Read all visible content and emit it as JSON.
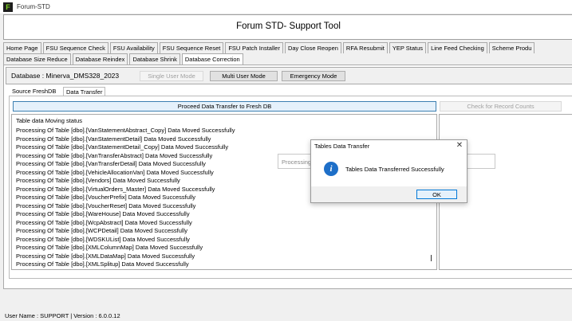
{
  "window": {
    "title": "Forum-STD",
    "icon_letter": "F"
  },
  "header": {
    "title": "Forum STD- Support Tool"
  },
  "main_tabs": [
    {
      "label": "Home Page"
    },
    {
      "label": "FSU Sequence Check"
    },
    {
      "label": "FSU Availability"
    },
    {
      "label": "FSU Sequence Reset"
    },
    {
      "label": "FSU Patch Installer"
    },
    {
      "label": "Day Close Reopen"
    },
    {
      "label": "RFA Resubmit"
    },
    {
      "label": "YEP Status"
    },
    {
      "label": "Line Feed Checking"
    },
    {
      "label": "Scheme Produ"
    }
  ],
  "db_tabs": [
    {
      "label": "Database Size Reduce"
    },
    {
      "label": "Database Reindex"
    },
    {
      "label": "Database Shrink"
    },
    {
      "label": "Database Correction",
      "active": true
    }
  ],
  "database": {
    "label": "Database :  Minerva_DMS328_2023",
    "single_user_mode": "Single User Mode",
    "multi_user_mode": "Multi User Mode",
    "emergency_mode": "Emergency Mode"
  },
  "sub_tabs": [
    {
      "label": "Source FreshDB"
    },
    {
      "label": "Data Transfer",
      "active": true
    }
  ],
  "transfer": {
    "proceed_button": "Proceed Data Transfer to Fresh DB",
    "check_button": "Check for Record Counts",
    "log_title": "Table data Moving status",
    "log": [
      "Processing Of Table [dbo].[VanStatementAbstract_Copy] Data Moved Successfully",
      "Processing Of Table [dbo].[VanStatementDetail] Data Moved Successfully",
      "Processing Of Table [dbo].[VanStatementDetail_Copy] Data Moved Successfully",
      "Processing Of Table [dbo].[VanTransferAbstract] Data Moved Successfully",
      "Processing Of Table [dbo].[VanTransferDetail] Data Moved Successfully",
      "Processing Of Table [dbo].[VehicleAllocationVan] Data Moved Successfully",
      "Processing Of Table [dbo].[Vendors] Data Moved Successfully",
      "Processing Of Table [dbo].[VirtualOrders_Master] Data Moved Successfully",
      "Processing Of Table [dbo].[VoucherPrefix] Data Moved Successfully",
      "Processing Of Table [dbo].[VoucherReset] Data Moved Successfully",
      "Processing Of Table [dbo].[WareHouse] Data Moved Successfully",
      "Processing Of Table [dbo].[WcpAbstract] Data Moved Successfully",
      "Processing Of Table [dbo].[WCPDetail] Data Moved Successfully",
      "Processing Of Table [dbo].[WDSKUList] Data Moved Successfully",
      "Processing Of Table [dbo].[XMLColumnMap] Data Moved Successfully",
      "Processing Of Table [dbo].[XMLDataMap] Data Moved Successfully",
      "Processing Of Table [dbo].[XMLSplitup] Data Moved Successfully"
    ],
    "processing_text": "Processing"
  },
  "dialog": {
    "title": "Tables Data Transfer",
    "close_glyph": "✕",
    "icon_glyph": "i",
    "message": "Tables Data Transferred Successfully",
    "ok_label": "OK"
  },
  "status": {
    "text": "User Name :  SUPPORT  |  Version : 6.0.0.12"
  }
}
